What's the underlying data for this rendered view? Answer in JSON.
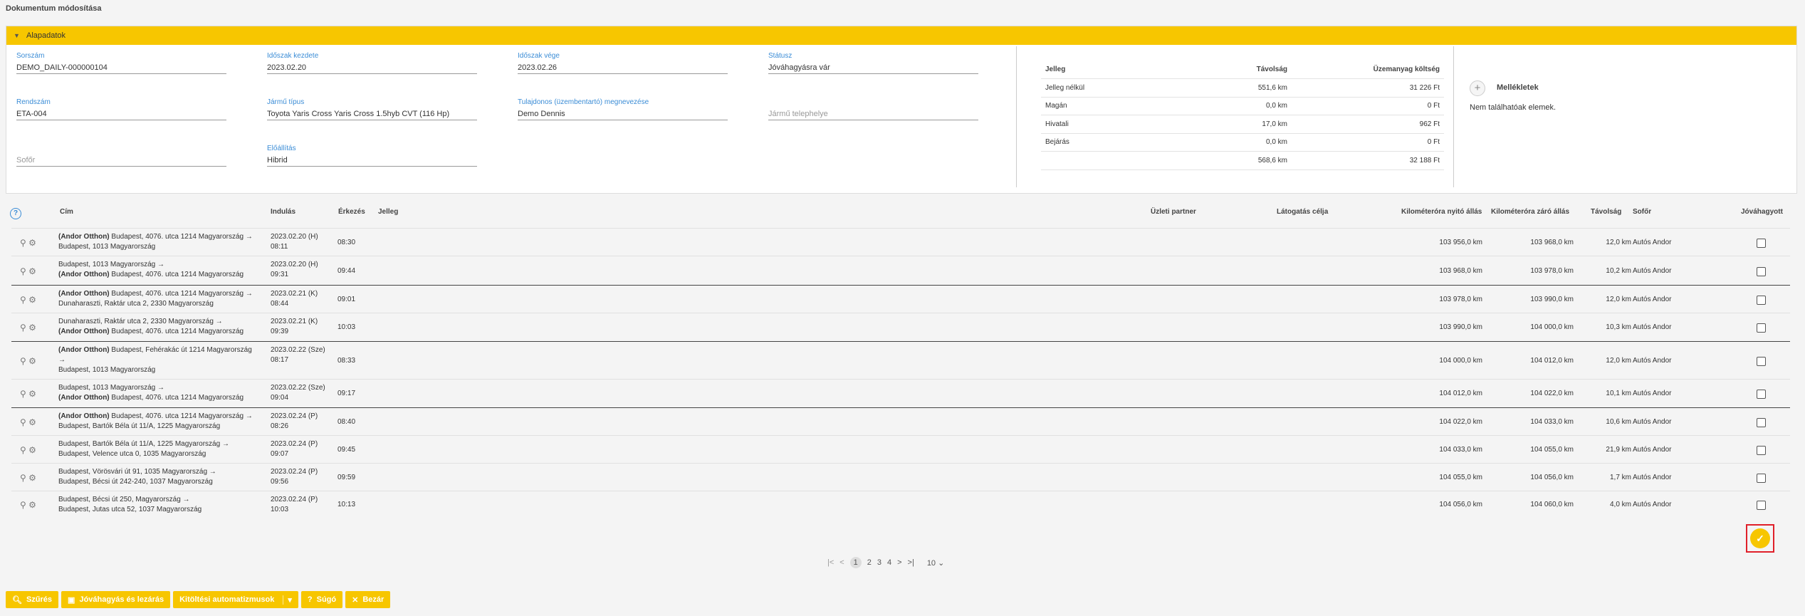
{
  "page_title": "Dokumentum módosítása",
  "panel_title": "Alapadatok",
  "fields": {
    "sorszam": {
      "label": "Sorszám",
      "value": "DEMO_DAILY-000000104"
    },
    "idoszak_kezdete": {
      "label": "Időszak kezdete",
      "value": "2023.02.20"
    },
    "idoszak_vege": {
      "label": "Időszak vége",
      "value": "2023.02.26"
    },
    "statusz": {
      "label": "Státusz",
      "value": "Jóváhagyásra vár"
    },
    "rendszam": {
      "label": "Rendszám",
      "value": "ETA-004"
    },
    "jarmu_tipus": {
      "label": "Jármű típus",
      "value": "Toyota Yaris Cross Yaris Cross 1.5hyb CVT (116 Hp)"
    },
    "tulajdonos": {
      "label": "Tulajdonos (üzembentartó) megnevezése",
      "value": "Demo Dennis"
    },
    "jarmu_telephelye": {
      "placeholder": "Jármű telephelye"
    },
    "sofor": {
      "placeholder": "Sofőr"
    },
    "elolitas": {
      "label": "Előállítás",
      "value": "Hibrid"
    }
  },
  "summary": {
    "headers": [
      "Jelleg",
      "Távolság",
      "Üzemanyag költség"
    ],
    "rows": [
      [
        "Jelleg nélkül",
        "551,6 km",
        "31 226 Ft"
      ],
      [
        "Magán",
        "0,0 km",
        "0 Ft"
      ],
      [
        "Hivatali",
        "17,0 km",
        "962 Ft"
      ],
      [
        "Bejárás",
        "0,0 km",
        "0 Ft"
      ],
      [
        "",
        "568,6 km",
        "32 188 Ft"
      ]
    ]
  },
  "attachments": {
    "title": "Mellékletek",
    "empty": "Nem találhatóak elemek."
  },
  "grid": {
    "headers": {
      "cim": "Cím",
      "indulas": "Indulás",
      "erkezes": "Érkezés",
      "jelleg": "Jelleg",
      "uzleti_partner": "Üzleti partner",
      "latogatas_celja": "Látogatás célja",
      "km_nyito": "Kilométeróra nyitó állás",
      "km_zaro": "Kilométeróra záró állás",
      "tavolsag": "Távolság",
      "sofor": "Sofőr",
      "jovahagyott": "Jóváhagyott"
    },
    "rows": [
      {
        "from_b": "(Andor Otthon)",
        "from": " Budapest, 4076. utca 1214 Magyarország →",
        "to_b": "",
        "to": "Budapest, 1013 Magyarország",
        "dep1": "2023.02.20 (H)",
        "dep2": "08:11",
        "arr": "08:30",
        "km_open": "103 956,0 km",
        "km_close": "103 968,0 km",
        "dist": "12,0 km",
        "driver": "Autós Andor"
      },
      {
        "from_b": "",
        "from": "Budapest, 1013 Magyarország →",
        "to_b": "(Andor Otthon)",
        "to": " Budapest, 4076. utca 1214 Magyarország",
        "dep1": "2023.02.20 (H)",
        "dep2": "09:31",
        "arr": "09:44",
        "km_open": "103 968,0 km",
        "km_close": "103 978,0 km",
        "dist": "10,2 km",
        "driver": "Autós Andor"
      },
      {
        "from_b": "(Andor Otthon)",
        "from": " Budapest, 4076. utca 1214 Magyarország →",
        "to_b": "",
        "to": "Dunaharaszti, Raktár utca 2, 2330 Magyarország",
        "dep1": "2023.02.21 (K)",
        "dep2": "08:44",
        "arr": "09:01",
        "km_open": "103 978,0 km",
        "km_close": "103 990,0 km",
        "dist": "12,0 km",
        "driver": "Autós Andor"
      },
      {
        "from_b": "",
        "from": "Dunaharaszti, Raktár utca 2, 2330 Magyarország →",
        "to_b": "(Andor Otthon)",
        "to": " Budapest, 4076. utca 1214 Magyarország",
        "dep1": "2023.02.21 (K)",
        "dep2": "09:39",
        "arr": "10:03",
        "km_open": "103 990,0 km",
        "km_close": "104 000,0 km",
        "dist": "10,3 km",
        "driver": "Autós Andor"
      },
      {
        "from_b": "(Andor Otthon)",
        "from": " Budapest, Fehérakác út 1214 Magyarország",
        "mid": "→",
        "to_b": "",
        "to": "Budapest, 1013 Magyarország",
        "dep1": "2023.02.22 (Sze)",
        "dep2": "08:17",
        "arr": "08:33",
        "km_open": "104 000,0 km",
        "km_close": "104 012,0 km",
        "dist": "12,0 km",
        "driver": "Autós Andor"
      },
      {
        "from_b": "",
        "from": "Budapest, 1013 Magyarország →",
        "to_b": "(Andor Otthon)",
        "to": " Budapest, 4076. utca 1214 Magyarország",
        "dep1": "2023.02.22 (Sze)",
        "dep2": "09:04",
        "arr": "09:17",
        "km_open": "104 012,0 km",
        "km_close": "104 022,0 km",
        "dist": "10,1 km",
        "driver": "Autós Andor"
      },
      {
        "from_b": "(Andor Otthon)",
        "from": " Budapest, 4076. utca 1214 Magyarország →",
        "to_b": "",
        "to": "Budapest, Bartók Béla út 11/A, 1225 Magyarország",
        "dep1": "2023.02.24 (P)",
        "dep2": "08:26",
        "arr": "08:40",
        "km_open": "104 022,0 km",
        "km_close": "104 033,0 km",
        "dist": "10,6 km",
        "driver": "Autós Andor"
      },
      {
        "from_b": "",
        "from": "Budapest, Bartók Béla út 11/A, 1225 Magyarország →",
        "to_b": "",
        "to": "Budapest, Velence utca 0, 1035 Magyarország",
        "dep1": "2023.02.24 (P)",
        "dep2": "09:07",
        "arr": "09:45",
        "km_open": "104 033,0 km",
        "km_close": "104 055,0 km",
        "dist": "21,9 km",
        "driver": "Autós Andor"
      },
      {
        "from_b": "",
        "from": "Budapest, Vörösvári út 91, 1035 Magyarország →",
        "to_b": "",
        "to": "Budapest, Bécsi út 242-240, 1037 Magyarország",
        "dep1": "2023.02.24 (P)",
        "dep2": "09:56",
        "arr": "09:59",
        "km_open": "104 055,0 km",
        "km_close": "104 056,0 km",
        "dist": "1,7 km",
        "driver": "Autós Andor"
      },
      {
        "from_b": "",
        "from": "Budapest, Bécsi út 250, Magyarország →",
        "to_b": "",
        "to": "Budapest, Jutas utca 52, 1037 Magyarország",
        "dep1": "2023.02.24 (P)",
        "dep2": "10:03",
        "arr": "10:13",
        "km_open": "104 056,0 km",
        "km_close": "104 060,0 km",
        "dist": "4,0 km",
        "driver": "Autós Andor"
      }
    ]
  },
  "pager": {
    "pages": [
      "1",
      "2",
      "3",
      "4"
    ],
    "page_size": "10"
  },
  "toolbar": {
    "szures": "Szűrés",
    "jovahagyas": "Jóváhagyás és lezárás",
    "kitoltesi": "Kitöltési automatizmusok",
    "sugo": "Súgó",
    "bezar": "Bezár"
  }
}
